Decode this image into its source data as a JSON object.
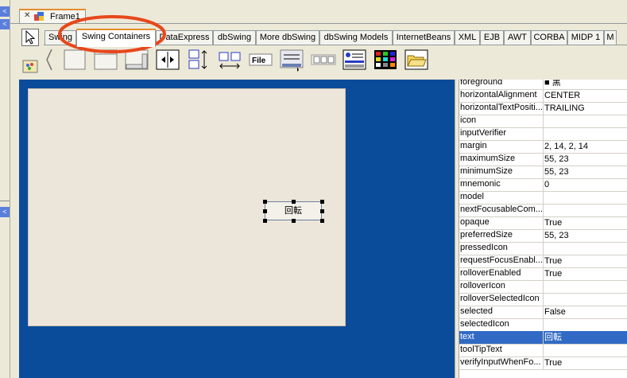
{
  "document_tab": {
    "title": "Frame1"
  },
  "palette_tabs": [
    {
      "label": "Swing"
    },
    {
      "label": "Swing Containers"
    },
    {
      "label": "DataExpress"
    },
    {
      "label": "dbSwing"
    },
    {
      "label": "More dbSwing"
    },
    {
      "label": "dbSwing Models"
    },
    {
      "label": "InternetBeans"
    },
    {
      "label": "XML"
    },
    {
      "label": "EJB"
    },
    {
      "label": "AWT"
    },
    {
      "label": "CORBA"
    },
    {
      "label": "MIDP 1"
    },
    {
      "label": "M"
    }
  ],
  "active_palette_tab": "Swing Containers",
  "components": [
    {
      "name": "panel",
      "icon": "panel-icon"
    },
    {
      "name": "scroll-pane",
      "icon": "scroll-pane-icon"
    },
    {
      "name": "tabbed-pane",
      "icon": "tabbed-pane-icon"
    },
    {
      "name": "split-pane",
      "icon": "split-pane-icon"
    },
    {
      "name": "box-layout",
      "icon": "box-layout-icon"
    },
    {
      "name": "box-glue",
      "icon": "box-glue-icon"
    },
    {
      "name": "menu-bar",
      "label": "File",
      "icon": "menu-bar-icon"
    },
    {
      "name": "toolbar",
      "icon": "toolbar-icon"
    },
    {
      "name": "layered",
      "icon": "layered-icon"
    },
    {
      "name": "internal-frame",
      "icon": "internal-frame-icon"
    },
    {
      "name": "desktop-pane",
      "icon": "desktop-pane-icon"
    },
    {
      "name": "file-chooser",
      "icon": "folder-icon"
    }
  ],
  "designer": {
    "button_text": "回転"
  },
  "inspector": {
    "properties": [
      {
        "name": "foreground",
        "value": "■ 黑"
      },
      {
        "name": "horizontalAlignment",
        "value": "CENTER"
      },
      {
        "name": "horizontalTextPositi...",
        "value": "TRAILING"
      },
      {
        "name": "icon",
        "value": ""
      },
      {
        "name": "inputVerifier",
        "value": ""
      },
      {
        "name": "margin",
        "value": "2, 14, 2, 14"
      },
      {
        "name": "maximumSize",
        "value": "55, 23"
      },
      {
        "name": "minimumSize",
        "value": "55, 23"
      },
      {
        "name": "mnemonic",
        "value": "0"
      },
      {
        "name": "model",
        "value": ""
      },
      {
        "name": "nextFocusableCom...",
        "value": ""
      },
      {
        "name": "opaque",
        "value": "True"
      },
      {
        "name": "preferredSize",
        "value": "55, 23"
      },
      {
        "name": "pressedIcon",
        "value": ""
      },
      {
        "name": "requestFocusEnabl...",
        "value": "True"
      },
      {
        "name": "rolloverEnabled",
        "value": "True"
      },
      {
        "name": "rolloverIcon",
        "value": ""
      },
      {
        "name": "rolloverSelectedIcon",
        "value": ""
      },
      {
        "name": "selected",
        "value": "False"
      },
      {
        "name": "selectedIcon",
        "value": ""
      },
      {
        "name": "text",
        "value": "回転"
      },
      {
        "name": "toolTipText",
        "value": ""
      },
      {
        "name": "verifyInputWhenFo...",
        "value": "True"
      }
    ],
    "selected_property": "text"
  },
  "colors": {
    "designer_background": "#0b4c9a",
    "selection": "#316ac5",
    "annotation": "#e8471c",
    "active_tab_accent": "#e68b2c"
  }
}
